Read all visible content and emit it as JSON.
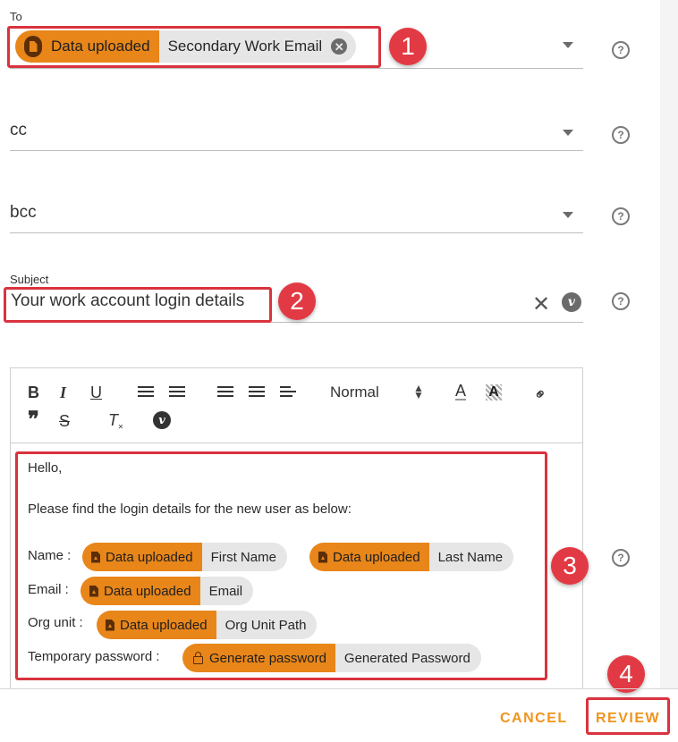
{
  "to": {
    "label": "To",
    "chip_source": "Data uploaded",
    "chip_value": "Secondary Work Email"
  },
  "cc": {
    "placeholder": "cc"
  },
  "bcc": {
    "placeholder": "bcc"
  },
  "subject": {
    "label": "Subject",
    "value": "Your work account login details"
  },
  "toolbar": {
    "bold": "B",
    "italic": "I",
    "underline": "U",
    "format_select": "Normal",
    "font_color": "A",
    "quote": "”",
    "strike": "S",
    "clear_format": "T",
    "variable": "v"
  },
  "body": {
    "greeting": "Hello,",
    "intro": "Please find the login details for the new user as below:",
    "name_label": "Name :",
    "name_first_source": "Data uploaded",
    "name_first_value": "First Name",
    "name_last_source": "Data uploaded",
    "name_last_value": "Last Name",
    "email_label": "Email :",
    "email_source": "Data uploaded",
    "email_value": "Email",
    "org_label": "Org unit :",
    "org_source": "Data uploaded",
    "org_value": "Org Unit Path",
    "password_label": "Temporary password :",
    "password_source": "Generate password",
    "password_value": "Generated Password"
  },
  "callouts": [
    "1",
    "2",
    "3",
    "4"
  ],
  "footer": {
    "cancel": "CANCEL",
    "review": "REVIEW"
  },
  "colors": {
    "accent": "#e8861a",
    "callout": "#e23a44",
    "button": "#f0941c"
  }
}
